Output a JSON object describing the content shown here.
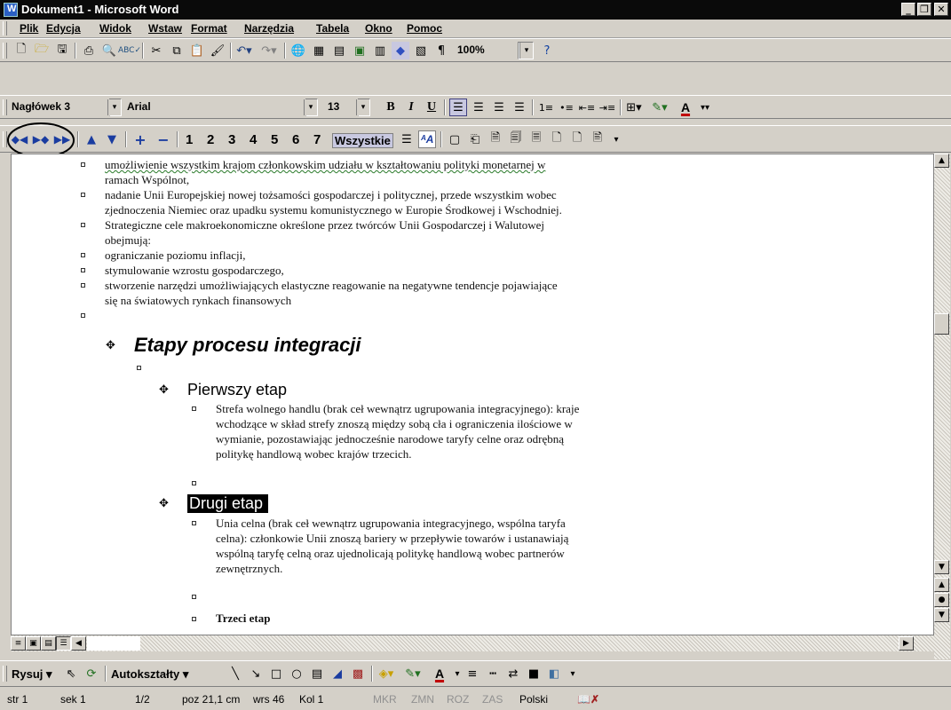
{
  "window": {
    "title": "Dokument1 - Microsoft Word"
  },
  "menu": [
    "Plik",
    "Edycja",
    "Widok",
    "Wstaw",
    "Format",
    "Narzędzia",
    "Tabela",
    "Okno",
    "Pomoc"
  ],
  "toolbar_standard": {
    "zoom": "100%"
  },
  "toolbar_formatting": {
    "style": "Nagłówek 3",
    "font": "Arial",
    "size": "13",
    "bold": "B",
    "italic": "I",
    "underline": "U"
  },
  "toolbar_outline": {
    "levels": [
      "1",
      "2",
      "3",
      "4",
      "5",
      "6",
      "7"
    ],
    "all_label": "Wszystkie"
  },
  "document": {
    "bullets_top": [
      {
        "lines": [
          "umożliwienie wszystkim krajom członkowskim udziału w kształtowaniu polityki monetarnej w",
          "ramach Wspólnot,"
        ]
      },
      {
        "lines": [
          "nadanie Unii Europejskiej nowej tożsamości gospodarczej i politycznej, przede wszystkim wobec",
          "zjednoczenia Niemiec oraz upadku systemu komunistycznego w Europie Środkowej i Wschodniej."
        ]
      },
      {
        "lines": [
          "Strategiczne cele makroekonomiczne określone przez twórców Unii Gospodarczej i Walutowej",
          "obejmują:"
        ]
      },
      {
        "lines": [
          "ograniczanie poziomu inflacji,"
        ]
      },
      {
        "lines": [
          "stymulowanie wzrostu gospodarczego,"
        ]
      },
      {
        "lines": [
          "stworzenie narzędzi umożliwiających elastyczne reagowanie na negatywne tendencje pojawiające",
          "się na światowych rynkach finansowych"
        ]
      }
    ],
    "heading2": "Etapy procesu integracji",
    "stage1": {
      "title": "Pierwszy etap",
      "lines": [
        "Strefa wolnego handlu (brak ceł wewnątrz ugrupowania integracyjnego): kraje",
        "wchodzące w skład strefy znoszą między sobą cła i ograniczenia ilościowe w",
        "wymianie, pozostawiając jednocześnie narodowe taryfy celne oraz odrębną",
        "politykę handlową wobec krajów trzecich."
      ]
    },
    "stage2": {
      "title": "Drugi etap",
      "lines": [
        "Unia celna (brak ceł wewnątrz ugrupowania integracyjnego, wspólna taryfa",
        "celna): członkowie Unii znoszą bariery w przepływie towarów i ustanawiają",
        "wspólną taryfę celną oraz ujednolicają politykę handlową wobec partnerów",
        "zewnętrznych."
      ]
    },
    "stage3": {
      "title": "Trzeci etap"
    }
  },
  "drawing_toolbar": {
    "draw": "Rysuj",
    "autoshapes": "Autokształty"
  },
  "status": {
    "page": "str 1",
    "section": "sek 1",
    "pages": "1/2",
    "position": "poz 21,1 cm",
    "line": "wrs 46",
    "col": "Kol 1",
    "mkr": "MKR",
    "zmn": "ZMN",
    "roz": "ROZ",
    "zas": "ZAS",
    "lang": "Polski"
  }
}
